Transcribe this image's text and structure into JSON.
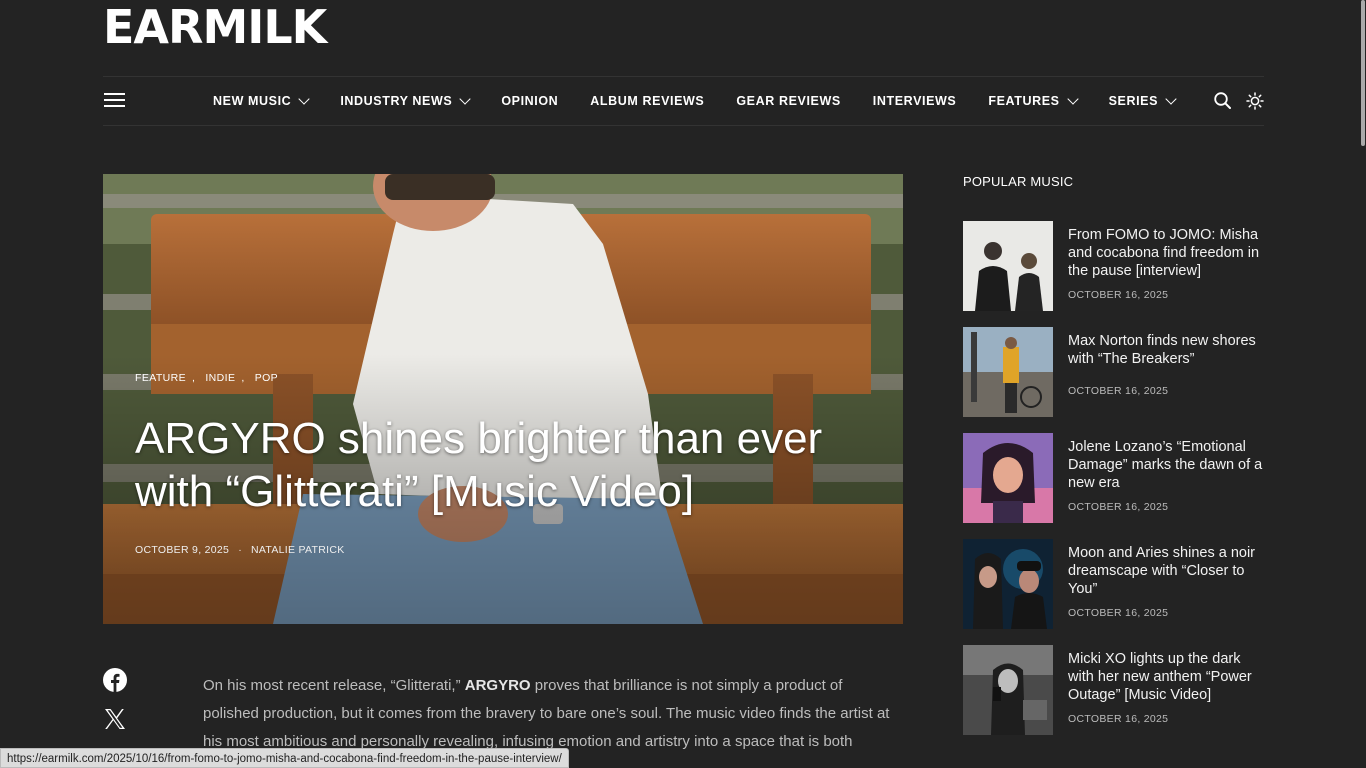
{
  "site": {
    "logo": "EARMILK"
  },
  "nav": {
    "items": [
      {
        "label": "NEW MUSIC",
        "dropdown": true
      },
      {
        "label": "INDUSTRY NEWS",
        "dropdown": true
      },
      {
        "label": "OPINION",
        "dropdown": false
      },
      {
        "label": "ALBUM REVIEWS",
        "dropdown": false
      },
      {
        "label": "GEAR REVIEWS",
        "dropdown": false
      },
      {
        "label": "INTERVIEWS",
        "dropdown": false
      },
      {
        "label": "FEATURES",
        "dropdown": true
      },
      {
        "label": "SERIES",
        "dropdown": true
      }
    ],
    "icons": [
      "hamburger-menu-icon",
      "search-icon",
      "sun-icon"
    ]
  },
  "hero": {
    "tags": [
      "FEATURE",
      "INDIE",
      "POP"
    ],
    "title": "ARGYRO shines brighter than ever with “Glitterati” [Music Video]",
    "date": "OCTOBER 9, 2025",
    "author": "NATALIE PATRICK"
  },
  "article": {
    "p1_before": "On his most recent release, “Glitterati,” ",
    "p1_bold": "ARGYRO",
    "p1_after": " proves that brilliance is not simply a product of polished production, but it comes from the bravery to bare one’s soul. The music video finds the artist at his most ambitious and personally revealing, infusing emotion and artistry into a space that is both"
  },
  "share": {
    "icons": [
      "facebook-icon",
      "x-icon"
    ]
  },
  "sidebar": {
    "title": "POPULAR MUSIC",
    "posts": [
      {
        "title": "From FOMO to JOMO: Misha and cocabona find freedom in the pause [interview]",
        "date": "OCTOBER 16, 2025"
      },
      {
        "title": "Max Norton finds new shores with “The Breakers”",
        "date": "OCTOBER 16, 2025"
      },
      {
        "title": "Jolene Lozano’s “Emotional Damage” marks the dawn of a new era",
        "date": "OCTOBER 16, 2025"
      },
      {
        "title": "Moon and Aries shines a noir dreamscape with “Closer to You”",
        "date": "OCTOBER 16, 2025"
      },
      {
        "title": "Micki XO lights up the dark with her new anthem “Power Outage” [Music Video]",
        "date": "OCTOBER 16, 2025"
      }
    ]
  },
  "status_bar": {
    "url": "https://earmilk.com/2025/10/16/from-fomo-to-jomo-misha-and-cocabona-find-freedom-in-the-pause-interview/"
  },
  "colors": {
    "background": "#232323",
    "text": "#ffffff",
    "muted": "#bdbdbd"
  }
}
